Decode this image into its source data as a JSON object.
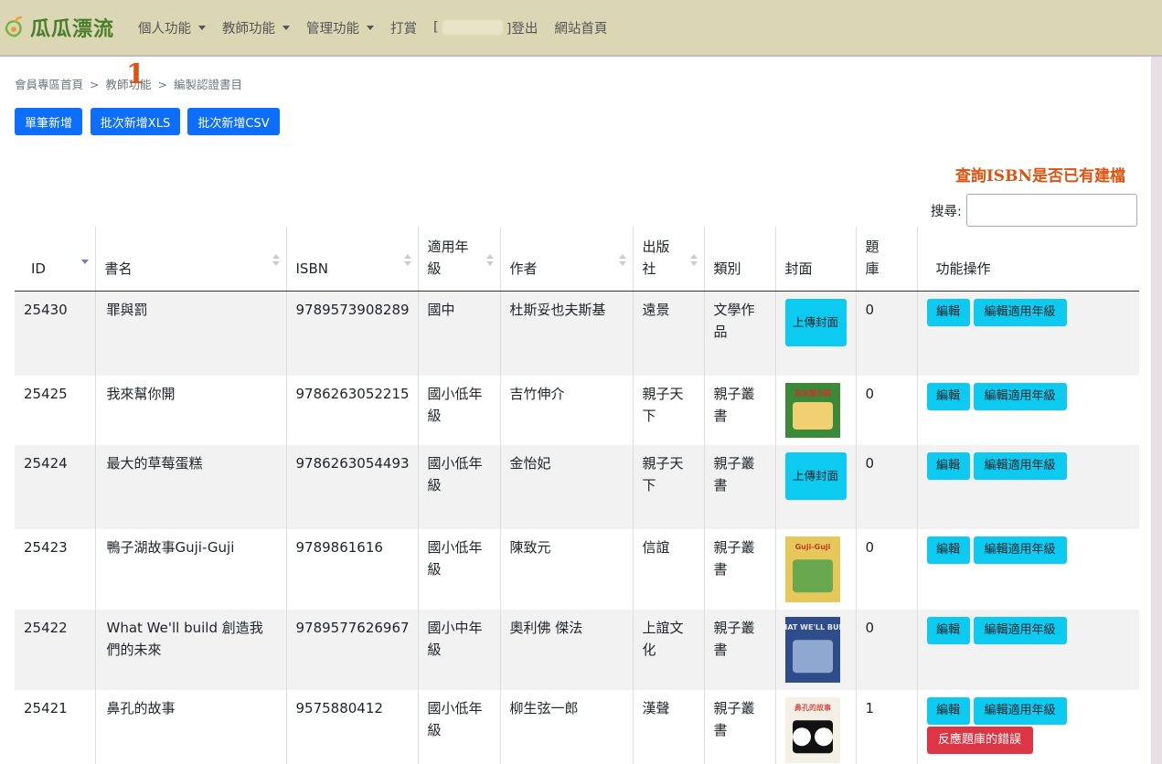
{
  "nav": {
    "brand": "瓜瓜漂流",
    "items": [
      "個人功能",
      "教師功能",
      "管理功能"
    ],
    "tip": "打賞",
    "bracket_open": "[",
    "logout": "]登出",
    "home": "網站首頁"
  },
  "breadcrumb": {
    "items": [
      "會員專區首頁",
      "教師功能",
      "編製認證書目"
    ],
    "separator": ">"
  },
  "annotation_marker": "1",
  "buttons": {
    "single_add": "單筆新增",
    "batch_xls": "批次新增XLS",
    "batch_csv": "批次新增CSV"
  },
  "note": "查詢ISBN是否已有建檔",
  "search": {
    "label": "搜尋:",
    "value": ""
  },
  "table": {
    "headers": [
      "ID",
      "書名",
      "ISBN",
      "適用年級",
      "作者",
      "出版社",
      "類別",
      "封面",
      "題庫",
      "功能操作"
    ],
    "upload_label": "上傳封面",
    "edit_label": "編輯",
    "edit_grade_label": "編輯適用年級",
    "error_label": "反應題庫的錯誤",
    "rows": [
      {
        "id": "25430",
        "title": "罪與罰",
        "isbn": "9789573908289",
        "grade": "國中",
        "author": "杜斯妥也夫斯基",
        "publisher": "遠景",
        "category": "文學作品",
        "cover": "upload",
        "quiz": "0",
        "error": false
      },
      {
        "id": "25425",
        "title": "我來幫你開",
        "isbn": "9786263052215",
        "grade": "國小低年級",
        "author": "吉竹伸介",
        "publisher": "親子天下",
        "category": "親子叢書",
        "cover": "image",
        "cover_text": "我來幫你開",
        "cover_colors": [
          "#3a8a3a",
          "#f0d070",
          "#c0392b"
        ],
        "quiz": "0",
        "error": false
      },
      {
        "id": "25424",
        "title": "最大的草莓蛋糕",
        "isbn": "9786263054493",
        "grade": "國小低年級",
        "author": "金怡妃",
        "publisher": "親子天下",
        "category": "親子叢書",
        "cover": "upload",
        "quiz": "0",
        "error": false
      },
      {
        "id": "25423",
        "title": "鴨子湖故事Guji-Guji",
        "isbn": "9789861616",
        "grade": "國小低年級",
        "author": "陳致元",
        "publisher": "信誼",
        "category": "親子叢書",
        "cover": "image",
        "cover_text": "Guji-Guji",
        "cover_colors": [
          "#e6c85a",
          "#6aa84f",
          "#c0392b"
        ],
        "quiz": "0",
        "error": false
      },
      {
        "id": "25422",
        "title": "What We'll build 創造我們的未來",
        "isbn": "9789577626967",
        "grade": "國小中年級",
        "author": "奧利佛 傑法",
        "publisher": "上誼文化",
        "category": "親子叢書",
        "cover": "image",
        "cover_text": "WHAT WE'LL BUILD",
        "cover_colors": [
          "#2f4d8a",
          "#8fa8cf",
          "#e8e8f0"
        ],
        "quiz": "0",
        "error": false
      },
      {
        "id": "25421",
        "title": "鼻孔的故事",
        "isbn": "9575880412",
        "grade": "國小低年級",
        "author": "柳生弦一郎",
        "publisher": "漢聲",
        "category": "親子叢書",
        "cover": "image",
        "cover_text": "鼻孔的故事",
        "cover_colors": [
          "#f5f0e6",
          "#111111",
          "#d9534f"
        ],
        "quiz": "1",
        "error": true
      }
    ]
  },
  "colors": {
    "navbar_bg": "#dbd6b3",
    "primary": "#0d6efd",
    "info": "#0dcaf0",
    "danger": "#dc3545",
    "annotation": "#e0520f"
  }
}
